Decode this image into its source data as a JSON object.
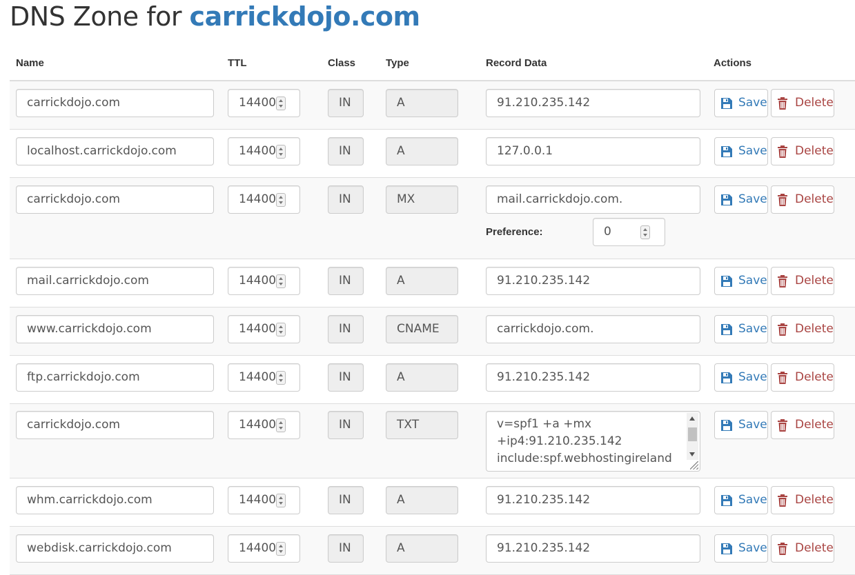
{
  "page": {
    "title_prefix": "DNS Zone for ",
    "domain": "carrickdojo.com"
  },
  "columns": {
    "name": "Name",
    "ttl": "TTL",
    "class": "Class",
    "type": "Type",
    "record_data": "Record Data",
    "actions": "Actions"
  },
  "actions": {
    "save_label": "Save",
    "delete_label": "Delete"
  },
  "mx": {
    "preference_label": "Preference:",
    "preference_value": "0"
  },
  "icons": {
    "save": "save-disk-icon",
    "delete": "trash-icon"
  },
  "colors": {
    "link": "#337ab7",
    "danger": "#a94442",
    "stripe": "#f9f9f9"
  },
  "records": [
    {
      "name": "carrickdojo.com",
      "ttl": "14400",
      "class": "IN",
      "type": "A",
      "data": "91.210.235.142"
    },
    {
      "name": "localhost.carrickdojo.com",
      "ttl": "14400",
      "class": "IN",
      "type": "A",
      "data": "127.0.0.1"
    },
    {
      "name": "carrickdojo.com",
      "ttl": "14400",
      "class": "IN",
      "type": "MX",
      "data": "mail.carrickdojo.com."
    },
    {
      "name": "mail.carrickdojo.com",
      "ttl": "14400",
      "class": "IN",
      "type": "A",
      "data": "91.210.235.142"
    },
    {
      "name": "www.carrickdojo.com",
      "ttl": "14400",
      "class": "IN",
      "type": "CNAME",
      "data": "carrickdojo.com."
    },
    {
      "name": "ftp.carrickdojo.com",
      "ttl": "14400",
      "class": "IN",
      "type": "A",
      "data": "91.210.235.142"
    },
    {
      "name": "carrickdojo.com",
      "ttl": "14400",
      "class": "IN",
      "type": "TXT",
      "data": "v=spf1 +a +mx\n+ip4:91.210.235.142\ninclude:spf.webhostingireland"
    },
    {
      "name": "whm.carrickdojo.com",
      "ttl": "14400",
      "class": "IN",
      "type": "A",
      "data": "91.210.235.142"
    },
    {
      "name": "webdisk.carrickdojo.com",
      "ttl": "14400",
      "class": "IN",
      "type": "A",
      "data": "91.210.235.142"
    }
  ]
}
